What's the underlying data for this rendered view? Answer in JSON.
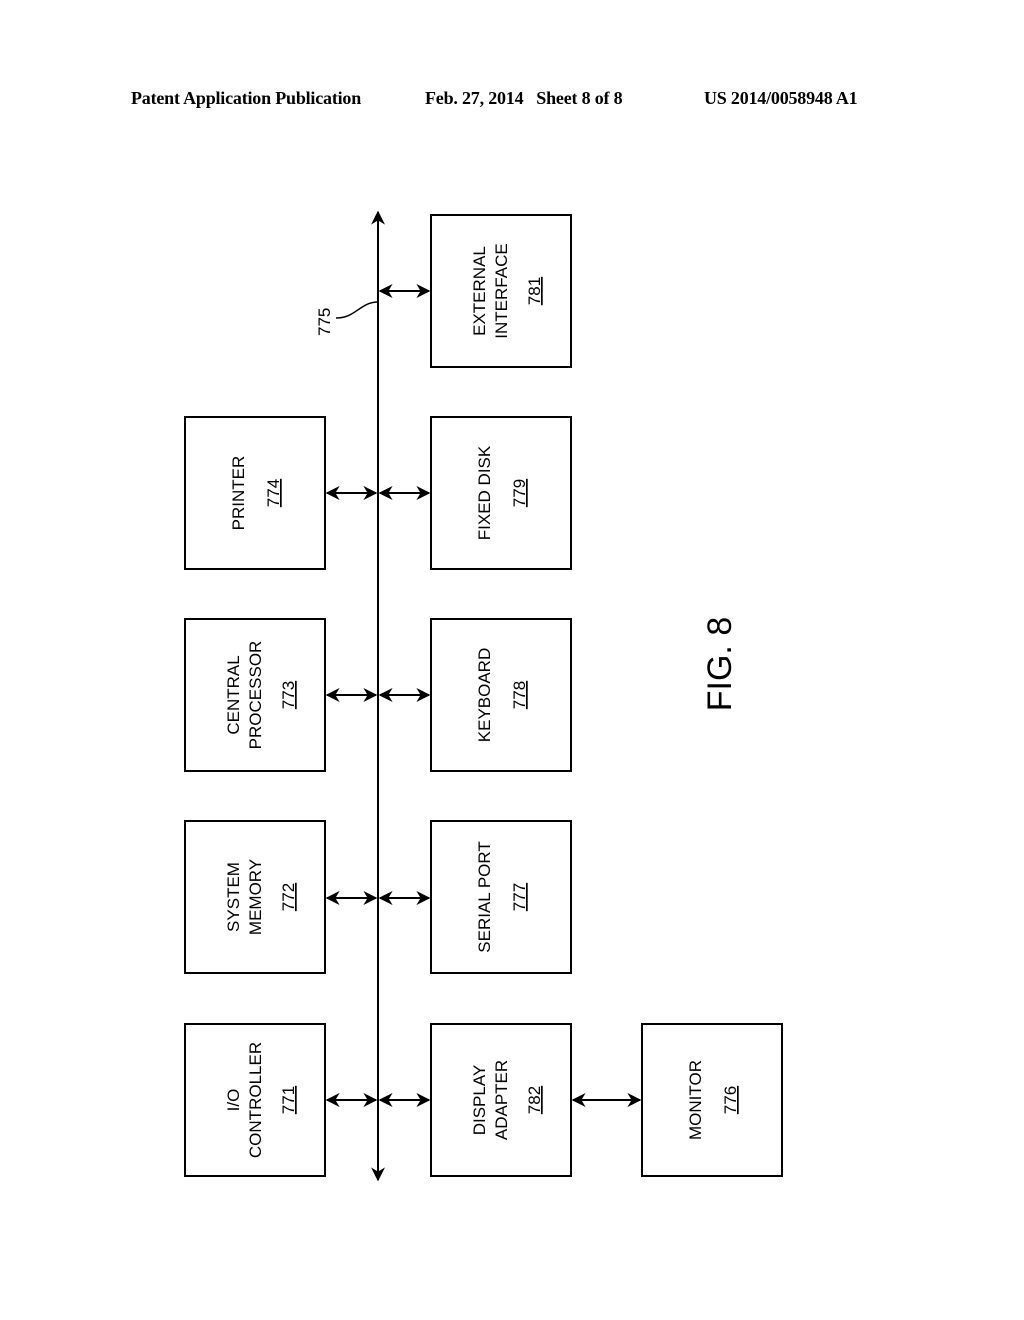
{
  "header": {
    "publication": "Patent Application Publication",
    "date_sheet": "Feb. 27, 2014   Sheet 8 of 8",
    "patent_number": "US 2014/0058948 A1"
  },
  "figure": {
    "label": "FIG. 8",
    "bus_ref": "775"
  },
  "blocks": {
    "io_controller": {
      "lines": [
        "I/O",
        "CONTROLLER"
      ],
      "ref": "771"
    },
    "system_memory": {
      "lines": [
        "SYSTEM",
        "MEMORY"
      ],
      "ref": "772"
    },
    "central_processor": {
      "lines": [
        "CENTRAL",
        "PROCESSOR"
      ],
      "ref": "773"
    },
    "printer": {
      "lines": [
        "PRINTER"
      ],
      "ref": "774"
    },
    "monitor": {
      "lines": [
        "MONITOR"
      ],
      "ref": "776"
    },
    "serial_port": {
      "lines": [
        "SERIAL PORT"
      ],
      "ref": "777"
    },
    "keyboard": {
      "lines": [
        "KEYBOARD"
      ],
      "ref": "778"
    },
    "fixed_disk": {
      "lines": [
        "FIXED DISK"
      ],
      "ref": "779"
    },
    "external_interface": {
      "lines": [
        "EXTERNAL",
        "INTERFACE"
      ],
      "ref": "781"
    },
    "display_adapter": {
      "lines": [
        "DISPLAY",
        "ADAPTER"
      ],
      "ref": "782"
    }
  }
}
